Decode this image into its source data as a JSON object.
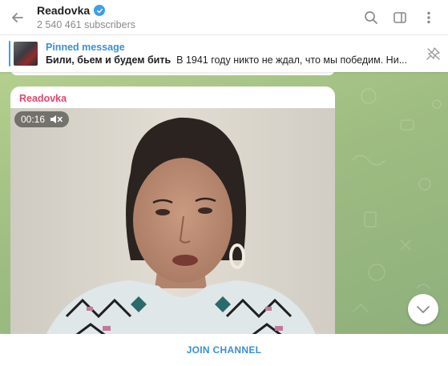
{
  "header": {
    "channel_name": "Readovka",
    "subscribers": "2 540 461 subscribers",
    "icons": [
      "back-arrow-icon",
      "verified-icon",
      "search-icon",
      "sidebar-toggle-icon",
      "more-vertical-icon"
    ]
  },
  "pinned": {
    "label": "Pinned message",
    "title": "Били, бьем и будем бить",
    "snippet": "В 1941 году никто не ждал, что мы победим. Ни..."
  },
  "message": {
    "sender": "Readovka",
    "duration": "00:16",
    "sender_color": "#e5446a"
  },
  "footer": {
    "join_label": "JOIN CHANNEL"
  },
  "colors": {
    "accent": "#3a8fd6",
    "chat_bg": "#9fbf83"
  }
}
